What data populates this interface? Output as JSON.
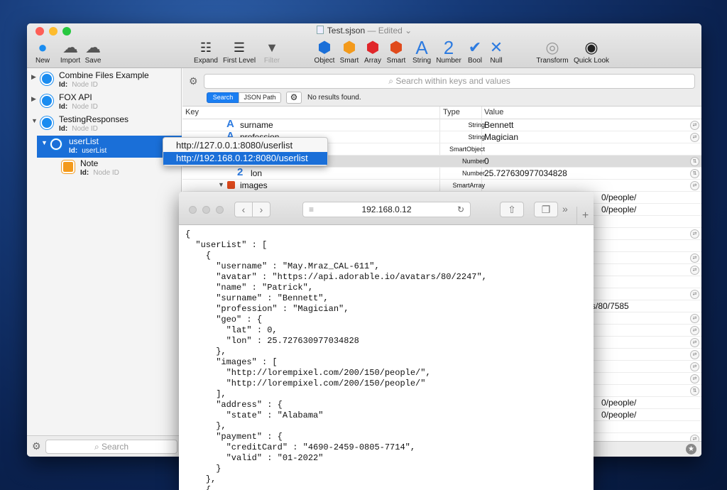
{
  "window": {
    "title": "Test.sjson",
    "edited": "— Edited",
    "colors": {
      "close": "#fe5f57",
      "minimize": "#febc2e",
      "zoom": "#28c840",
      "selection": "#1a6fd8",
      "accent": "#2d7be0"
    }
  },
  "toolbar": {
    "new": "New",
    "import": "Import",
    "save": "Save",
    "expand": "Expand",
    "first_level": "First Level",
    "filter": "Filter",
    "object": "Object",
    "smart": "Smart",
    "array": "Array",
    "smart2": "Smart",
    "string": "String",
    "number": "Number",
    "bool": "Bool",
    "null": "Null",
    "transform": "Transform",
    "quick_look": "Quick Look"
  },
  "sidebar": {
    "nodes": [
      {
        "name": "Combine Files Example",
        "id_label": "Id:",
        "id_value": "Node ID"
      },
      {
        "name": "FOX API",
        "id_label": "Id:",
        "id_value": "Node ID"
      },
      {
        "name": "TestingResponses",
        "id_label": "Id:",
        "id_value": "Node ID"
      },
      {
        "name": "userList",
        "id_label": "Id:",
        "id_value": "userList"
      },
      {
        "name": "Note",
        "id_label": "Id:",
        "id_value": "Node ID"
      }
    ],
    "search_placeholder": "Search"
  },
  "search": {
    "placeholder": "Search within keys and values",
    "mode_search": "Search",
    "mode_json_path": "JSON Path",
    "status": "No results found."
  },
  "table": {
    "headers": {
      "key": "Key",
      "type": "Type",
      "value": "Value"
    },
    "rows": [
      {
        "icon": "A",
        "key": "surname",
        "type": "String",
        "value": "Bennett"
      },
      {
        "icon": "A",
        "key": "profession",
        "type": "String",
        "value": "Magician"
      },
      {
        "icon": "",
        "key": "",
        "type": "SmartObject",
        "value": ""
      },
      {
        "icon": "",
        "key": "",
        "type": "Number",
        "value": "0"
      },
      {
        "icon": "2",
        "key": "lon",
        "type": "Number",
        "value": "25.727630977034828"
      },
      {
        "icon": "",
        "key": "images",
        "type": "SmartArray",
        "value": ""
      }
    ],
    "partial_values": [
      "0/people/",
      "0/people/",
      "s/80/7585",
      "0/people/",
      "0/people/"
    ]
  },
  "popup": {
    "items": [
      "http://127.0.0.1:8080/userlist",
      "http://192.168.0.12:8080/userlist"
    ]
  },
  "browser": {
    "url": "192.168.0.12",
    "json_lines": [
      "{",
      "  \"userList\" : [",
      "    {",
      "      \"username\" : \"May.Mraz_CAL-611\",",
      "      \"avatar\" : \"https://api.adorable.io/avatars/80/2247\",",
      "      \"name\" : \"Patrick\",",
      "      \"surname\" : \"Bennett\",",
      "      \"profession\" : \"Magician\",",
      "      \"geo\" : {",
      "        \"lat\" : 0,",
      "        \"lon\" : 25.727630977034828",
      "      },",
      "      \"images\" : [",
      "        \"http://lorempixel.com/200/150/people/\",",
      "        \"http://lorempixel.com/200/150/people/\"",
      "      ],",
      "      \"address\" : {",
      "        \"state\" : \"Alabama\"",
      "      },",
      "      \"payment\" : {",
      "        \"creditCard\" : \"4690-2459-0805-7714\",",
      "        \"valid\" : \"01-2022\"",
      "      }",
      "    },",
      "    {"
    ]
  }
}
